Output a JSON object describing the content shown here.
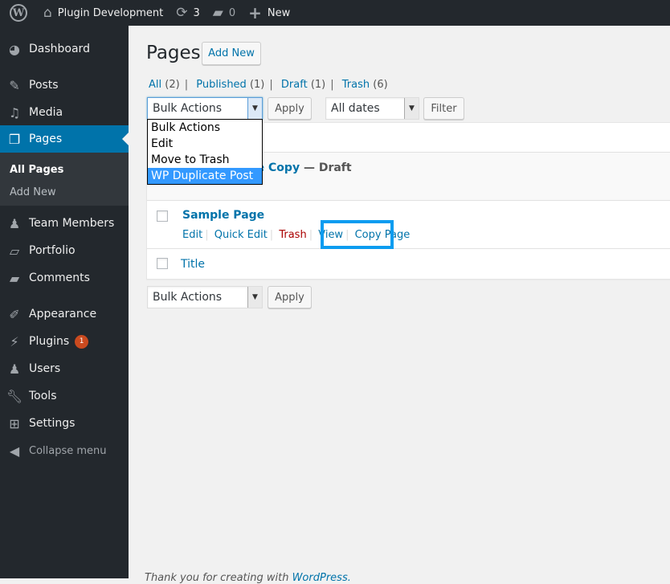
{
  "adminbar": {
    "site_name": "Plugin Development",
    "updates_count": "3",
    "comments_count": "0",
    "new_label": "New"
  },
  "sidebar": {
    "items": [
      {
        "label": "Dashboard",
        "icon": "dashboard-icon"
      },
      {
        "label": "Posts",
        "icon": "pin-icon"
      },
      {
        "label": "Media",
        "icon": "media-icon"
      },
      {
        "label": "Pages",
        "icon": "pages-icon"
      },
      {
        "label": "Team Members",
        "icon": "person-icon"
      },
      {
        "label": "Portfolio",
        "icon": "folder-icon"
      },
      {
        "label": "Comments",
        "icon": "comment-icon"
      },
      {
        "label": "Appearance",
        "icon": "brush-icon"
      },
      {
        "label": "Plugins",
        "icon": "plug-icon",
        "badge": "1"
      },
      {
        "label": "Users",
        "icon": "users-icon"
      },
      {
        "label": "Tools",
        "icon": "wrench-icon"
      },
      {
        "label": "Settings",
        "icon": "sliders-icon"
      }
    ],
    "submenu": [
      "All Pages",
      "Add New"
    ],
    "collapse_label": "Collapse menu"
  },
  "main": {
    "title": "Pages",
    "add_new": "Add New",
    "filters": [
      {
        "label": "All",
        "count": "(2)"
      },
      {
        "label": "Published",
        "count": "(1)"
      },
      {
        "label": "Draft",
        "count": "(1)"
      },
      {
        "label": "Trash",
        "count": "(6)"
      }
    ],
    "bulk_actions_selected": "Bulk Actions",
    "bulk_options": [
      "Bulk Actions",
      "Edit",
      "Move to Trash",
      "WP Duplicate Post"
    ],
    "apply_label": "Apply",
    "dates_selected": "All dates",
    "filter_label": "Filter",
    "rows": [
      {
        "title": "Sample Page Copy",
        "state": " — Draft"
      },
      {
        "title": "Sample Page",
        "actions": [
          "Edit",
          "Quick Edit",
          "Trash",
          "View",
          "Copy Page"
        ]
      }
    ],
    "footer_column": "Title",
    "footer_text": "Thank you for creating with ",
    "footer_link": "WordPress."
  }
}
